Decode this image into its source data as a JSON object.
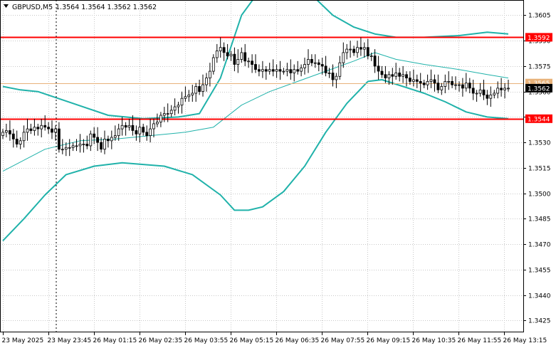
{
  "header": {
    "symbol": "GBPUSD,M5",
    "ohlc": "1.3564 1.3564 1.3562 1.3562"
  },
  "chart_data": {
    "type": "candlestick",
    "symbol": "GBPUSD",
    "timeframe": "M5",
    "ylim": [
      1.3418,
      1.3614
    ],
    "y_ticks": [
      "1.3605",
      "1.3590",
      "1.3575",
      "1.3560",
      "1.3545",
      "1.3530",
      "1.3515",
      "1.3500",
      "1.3485",
      "1.3470",
      "1.3455",
      "1.3440",
      "1.3425"
    ],
    "x_ticks": [
      "23 May 2025",
      "23 May 23:45",
      "26 May 01:15",
      "26 May 02:35",
      "26 May 03:55",
      "26 May 05:15",
      "26 May 06:35",
      "26 May 07:55",
      "26 May 09:15",
      "26 May 10:35",
      "26 May 11:55",
      "26 May 13:15"
    ],
    "close": [
      1.3536,
      1.3537,
      1.3535,
      1.3532,
      1.3529,
      1.3531,
      1.3536,
      1.3538,
      1.3537,
      1.3539,
      1.3538,
      1.354,
      1.3539,
      1.3538,
      1.3536,
      1.3538,
      1.3526,
      1.3526,
      1.3527,
      1.3527,
      1.3528,
      1.3528,
      1.3529,
      1.3529,
      1.3528,
      1.3535,
      1.3533,
      1.353,
      1.3526,
      1.3532,
      1.3531,
      1.3533,
      1.3534,
      1.3538,
      1.354,
      1.3539,
      1.354,
      1.3537,
      1.3535,
      1.3539,
      1.3536,
      1.3534,
      1.3538,
      1.3541,
      1.3542,
      1.3546,
      1.3547,
      1.3547,
      1.3549,
      1.3551,
      1.3552,
      1.3556,
      1.3557,
      1.3558,
      1.3559,
      1.3563,
      1.356,
      1.3564,
      1.3568,
      1.3572,
      1.358,
      1.3584,
      1.3586,
      1.3583,
      1.3581,
      1.3582,
      1.3576,
      1.3579,
      1.3583,
      1.3578,
      1.3578,
      1.3576,
      1.3573,
      1.3572,
      1.3573,
      1.3572,
      1.3573,
      1.3572,
      1.3573,
      1.3572,
      1.3572,
      1.3573,
      1.3571,
      1.3573,
      1.3572,
      1.3574,
      1.3576,
      1.3579,
      1.3577,
      1.3577,
      1.3576,
      1.3575,
      1.3571,
      1.3571,
      1.3567,
      1.3569,
      1.3577,
      1.3583,
      1.3585,
      1.3585,
      1.3583,
      1.3586,
      1.3585,
      1.3586,
      1.3581,
      1.3581,
      1.3575,
      1.3572,
      1.357,
      1.3568,
      1.357,
      1.3569,
      1.3571,
      1.3569,
      1.357,
      1.3568,
      1.3566,
      1.3567,
      1.3566,
      1.3565,
      1.3564,
      1.3566,
      1.3567,
      1.3565,
      1.3561,
      1.3563,
      1.3566,
      1.3566,
      1.3564,
      1.3564,
      1.3564,
      1.3562,
      1.3565,
      1.3562,
      1.3559,
      1.3559,
      1.3561,
      1.3558,
      1.3556,
      1.3558,
      1.3559,
      1.3562,
      1.3561,
      1.3562,
      1.3562
    ],
    "levels": [
      {
        "label": "1.3592",
        "value": 1.3592,
        "color": "#ff0000"
      },
      {
        "label": "1.3565",
        "value": 1.3565,
        "color": "#e8b27a"
      },
      {
        "label": "1.3544",
        "value": 1.3544,
        "color": "#ff0000"
      }
    ],
    "current_price": {
      "label": "1.3562",
      "value": 1.3562
    },
    "bands": {
      "upper": [
        [
          0,
          1.3563
        ],
        [
          5,
          1.3561
        ],
        [
          10,
          1.356
        ],
        [
          20,
          1.3553
        ],
        [
          30,
          1.3546
        ],
        [
          40,
          1.3544
        ],
        [
          50,
          1.3545
        ],
        [
          56,
          1.3547
        ],
        [
          62,
          1.3568
        ],
        [
          68,
          1.3605
        ],
        [
          74,
          1.3622
        ],
        [
          82,
          1.3627
        ],
        [
          88,
          1.3617
        ],
        [
          94,
          1.3605
        ],
        [
          100,
          1.3598
        ],
        [
          106,
          1.3594
        ],
        [
          112,
          1.3592
        ],
        [
          120,
          1.3592
        ],
        [
          130,
          1.3593
        ],
        [
          138,
          1.3595
        ],
        [
          144,
          1.3594
        ]
      ],
      "middle": [
        [
          0,
          1.3513
        ],
        [
          12,
          1.3526
        ],
        [
          22,
          1.3531
        ],
        [
          32,
          1.3532
        ],
        [
          42,
          1.3534
        ],
        [
          52,
          1.3536
        ],
        [
          60,
          1.3539
        ],
        [
          68,
          1.3552
        ],
        [
          76,
          1.356
        ],
        [
          84,
          1.3566
        ],
        [
          92,
          1.3572
        ],
        [
          100,
          1.3578
        ],
        [
          106,
          1.3583
        ],
        [
          112,
          1.3579
        ],
        [
          120,
          1.3576
        ],
        [
          130,
          1.3573
        ],
        [
          138,
          1.357
        ],
        [
          144,
          1.3568
        ]
      ],
      "lower": [
        [
          0,
          1.3472
        ],
        [
          6,
          1.3485
        ],
        [
          12,
          1.3499
        ],
        [
          18,
          1.3511
        ],
        [
          26,
          1.3516
        ],
        [
          34,
          1.3518
        ],
        [
          40,
          1.3517
        ],
        [
          46,
          1.3516
        ],
        [
          54,
          1.3511
        ],
        [
          62,
          1.3499
        ],
        [
          66,
          1.349
        ],
        [
          70,
          1.349
        ],
        [
          74,
          1.3492
        ],
        [
          80,
          1.3501
        ],
        [
          86,
          1.3516
        ],
        [
          92,
          1.3536
        ],
        [
          98,
          1.3553
        ],
        [
          104,
          1.3566
        ],
        [
          108,
          1.3567
        ],
        [
          114,
          1.3563
        ],
        [
          120,
          1.3559
        ],
        [
          126,
          1.3554
        ],
        [
          132,
          1.3548
        ],
        [
          138,
          1.3545
        ],
        [
          144,
          1.3544
        ]
      ]
    },
    "colors": {
      "band": "#20b2aa",
      "candle": "#000000"
    }
  }
}
